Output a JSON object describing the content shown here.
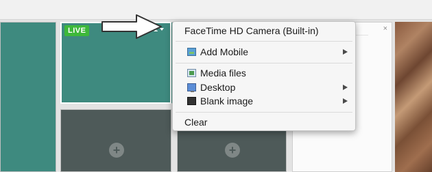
{
  "tile": {
    "live_badge": "LIVE",
    "source_number": "1",
    "add_symbol": "+"
  },
  "panel": {
    "close_symbol": "×"
  },
  "menu": {
    "items": [
      {
        "label": "FaceTime HD Camera (Built-in)",
        "icon": "",
        "has_submenu": false
      },
      {
        "label": "Add Mobile",
        "icon": "photo-icon",
        "has_submenu": true
      },
      {
        "label": "Media files",
        "icon": "media-files-icon",
        "has_submenu": false
      },
      {
        "label": "Desktop",
        "icon": "desktop-icon",
        "has_submenu": true
      },
      {
        "label": "Blank image",
        "icon": "blank-image-icon",
        "has_submenu": true
      },
      {
        "label": "Clear",
        "icon": "",
        "has_submenu": false
      }
    ]
  },
  "colors": {
    "live_badge": "#3db83a",
    "teal_tile": "#3e8a7f",
    "slate_tile": "#4e5a59"
  }
}
